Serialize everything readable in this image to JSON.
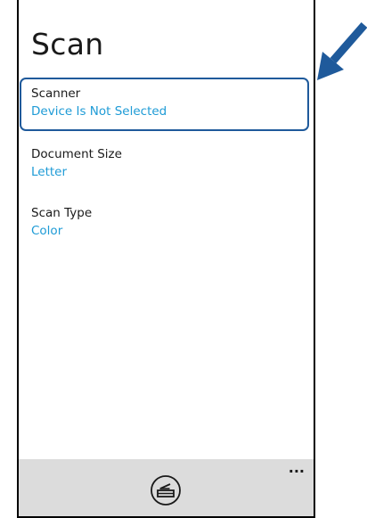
{
  "page": {
    "title": "Scan"
  },
  "settings": [
    {
      "label": "Scanner",
      "value": "Device Is Not Selected"
    },
    {
      "label": "Document Size",
      "value": "Letter"
    },
    {
      "label": "Scan Type",
      "value": "Color"
    }
  ],
  "app_bar": {
    "scan_icon": "scan-icon",
    "more_label": "..."
  },
  "colors": {
    "accent": "#1e9bd6",
    "highlight": "#1f5a9b",
    "app_bar_bg": "#dcdcdc",
    "arrow": "#1f5a9b"
  }
}
